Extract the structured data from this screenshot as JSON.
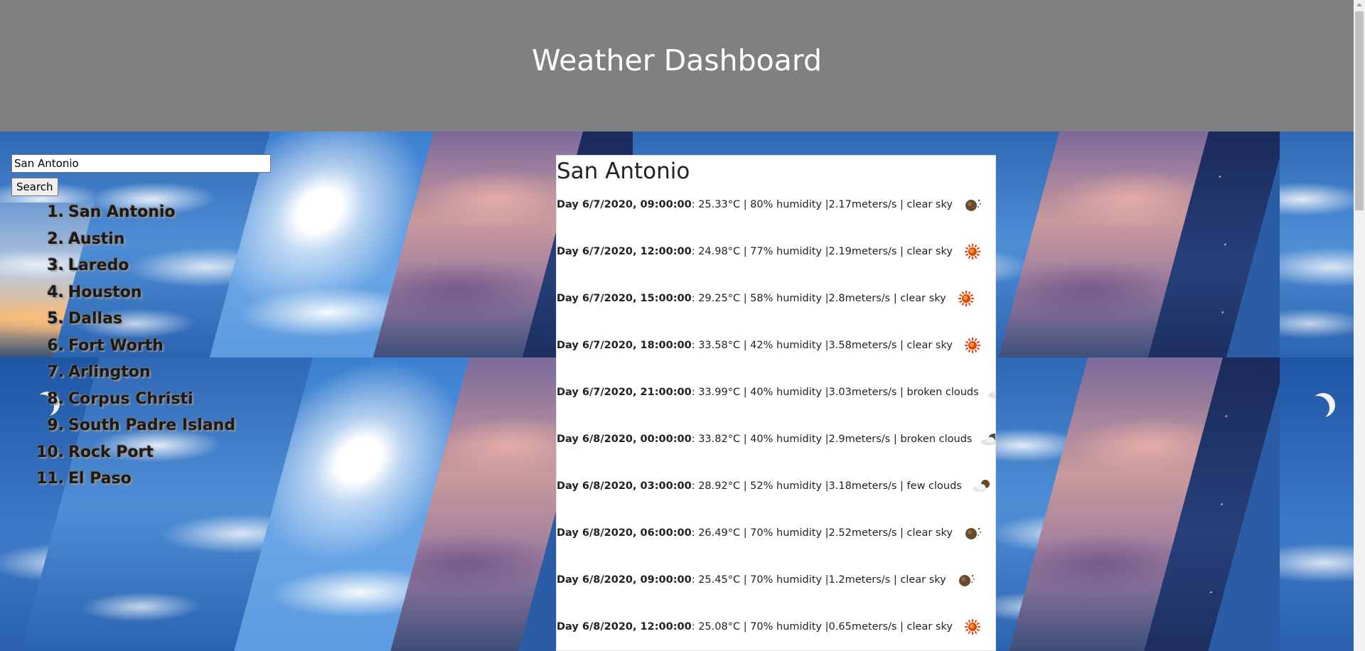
{
  "app": {
    "title": "Weather Dashboard"
  },
  "search": {
    "value": "San Antonio",
    "button_label": "Search"
  },
  "history": [
    {
      "number": "1.",
      "city": "San Antonio"
    },
    {
      "number": "2.",
      "city": "Austin"
    },
    {
      "number": "3.",
      "city": "Laredo"
    },
    {
      "number": "4.",
      "city": "Houston"
    },
    {
      "number": "5.",
      "city": "Dallas"
    },
    {
      "number": "6.",
      "city": "Fort Worth"
    },
    {
      "number": "7.",
      "city": "Arlington"
    },
    {
      "number": "8.",
      "city": "Corpus Christi"
    },
    {
      "number": "9.",
      "city": "South Padre Island"
    },
    {
      "number": "10.",
      "city": "Rock Port"
    },
    {
      "number": "11.",
      "city": "El Paso"
    }
  ],
  "forecast": {
    "city": "San Antonio",
    "entries": [
      {
        "day": "Day 6/7/2020, 09:00:00",
        "detail": ": 25.33°C | 80% humidity |2.17meters/s | clear sky",
        "icon": "clear-night-icon"
      },
      {
        "day": "Day 6/7/2020, 12:00:00",
        "detail": ": 24.98°C | 77% humidity |2.19meters/s | clear sky",
        "icon": "sun-icon"
      },
      {
        "day": "Day 6/7/2020, 15:00:00",
        "detail": ": 29.25°C | 58% humidity |2.8meters/s | clear sky",
        "icon": "sun-icon"
      },
      {
        "day": "Day 6/7/2020, 18:00:00",
        "detail": ": 33.58°C | 42% humidity |3.58meters/s | clear sky",
        "icon": "sun-icon"
      },
      {
        "day": "Day 6/7/2020, 21:00:00",
        "detail": ": 33.99°C | 40% humidity |3.03meters/s | broken clouds",
        "icon": "broken-clouds-icon"
      },
      {
        "day": "Day 6/8/2020, 00:00:00",
        "detail": ": 33.82°C | 40% humidity |2.9meters/s | broken clouds",
        "icon": "broken-clouds-icon"
      },
      {
        "day": "Day 6/8/2020, 03:00:00",
        "detail": ": 28.92°C | 52% humidity |3.18meters/s | few clouds",
        "icon": "few-clouds-night-icon"
      },
      {
        "day": "Day 6/8/2020, 06:00:00",
        "detail": ": 26.49°C | 70% humidity |2.52meters/s | clear sky",
        "icon": "clear-night-icon"
      },
      {
        "day": "Day 6/8/2020, 09:00:00",
        "detail": ": 25.45°C | 70% humidity |1.2meters/s | clear sky",
        "icon": "clear-night-icon"
      },
      {
        "day": "Day 6/8/2020, 12:00:00",
        "detail": ": 25.08°C | 70% humidity |0.65meters/s | clear sky",
        "icon": "sun-icon"
      }
    ]
  },
  "colors": {
    "header_bg": "#808080",
    "header_text": "#ffffff",
    "card_bg": "#ffffff",
    "sun": "#e8420f",
    "sun_core": "#f5a623",
    "night_orb": "#6b4a2c"
  }
}
